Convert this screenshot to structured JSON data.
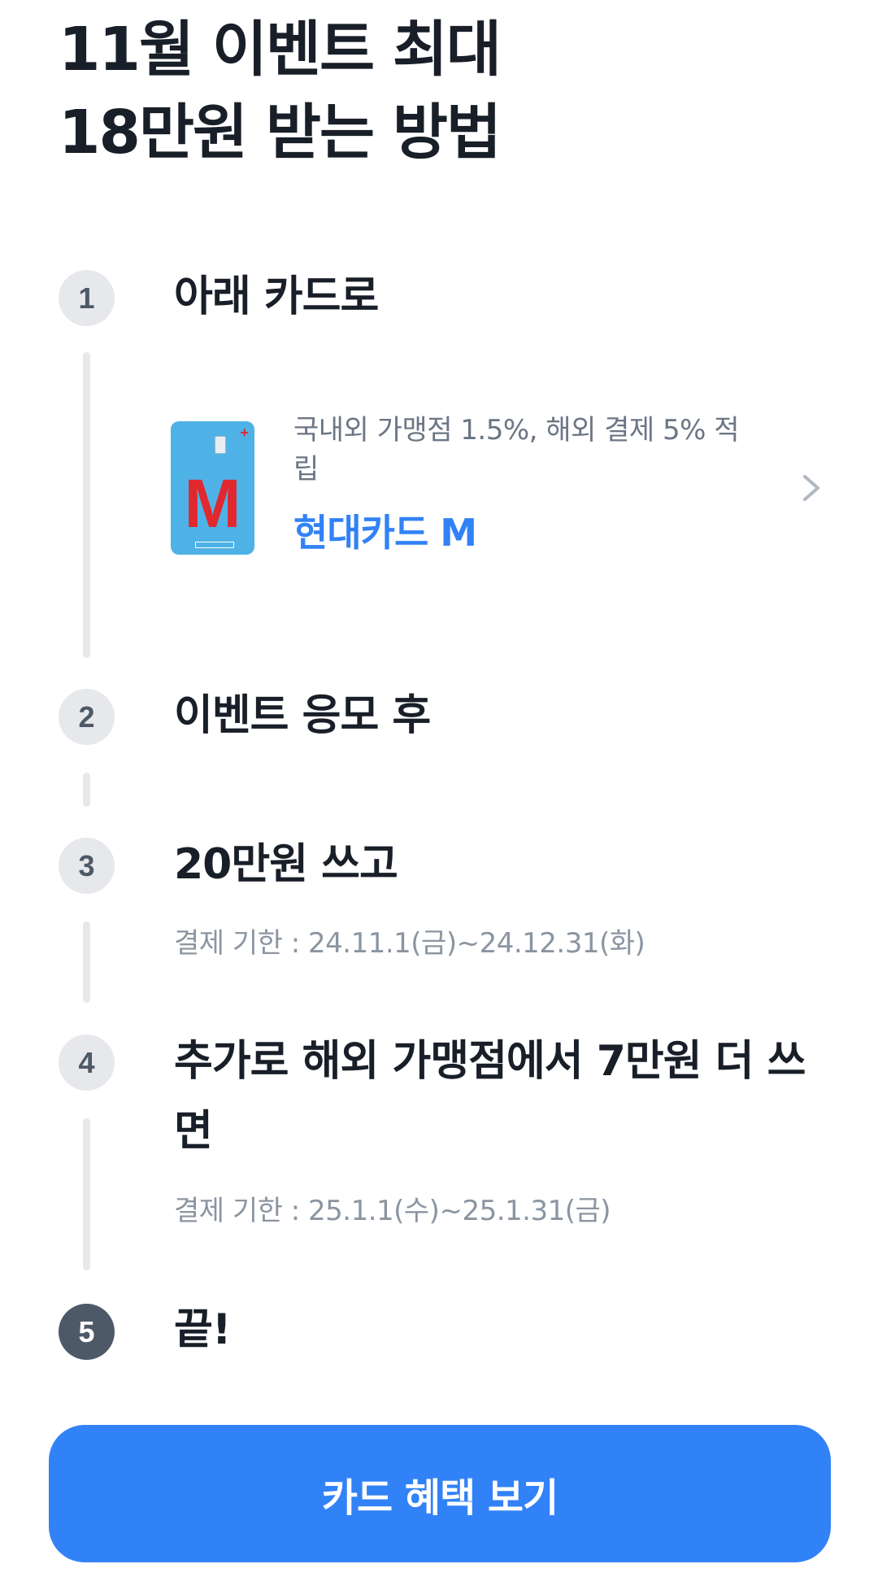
{
  "header": {
    "title_line1": "11월 이벤트 최대",
    "title_line2": "18만원 받는 방법"
  },
  "steps": [
    {
      "number": "1",
      "title": "아래 카드로"
    },
    {
      "number": "2",
      "title": "이벤트 응모 후"
    },
    {
      "number": "3",
      "title": "20만원 쓰고",
      "subtitle": "결제 기한 : 24.11.1(금)~24.12.31(화)"
    },
    {
      "number": "4",
      "title": "추가로 해외 가맹점에서 7만원 더 쓰면",
      "subtitle": "결제 기한 : 25.1.1(수)~25.1.31(금)"
    },
    {
      "number": "5",
      "title": "끝!"
    }
  ],
  "card": {
    "description": "국내외 가맹점 1.5%, 해외 결제 5% 적립",
    "name": "현대카드 M",
    "card_letter": "M",
    "card_color": "#4fb2e6",
    "letter_color": "#e0282e"
  },
  "cta": {
    "label": "카드 혜택 보기",
    "color": "#3182f6"
  },
  "icons": {
    "chevron": "chevron-right-icon"
  }
}
